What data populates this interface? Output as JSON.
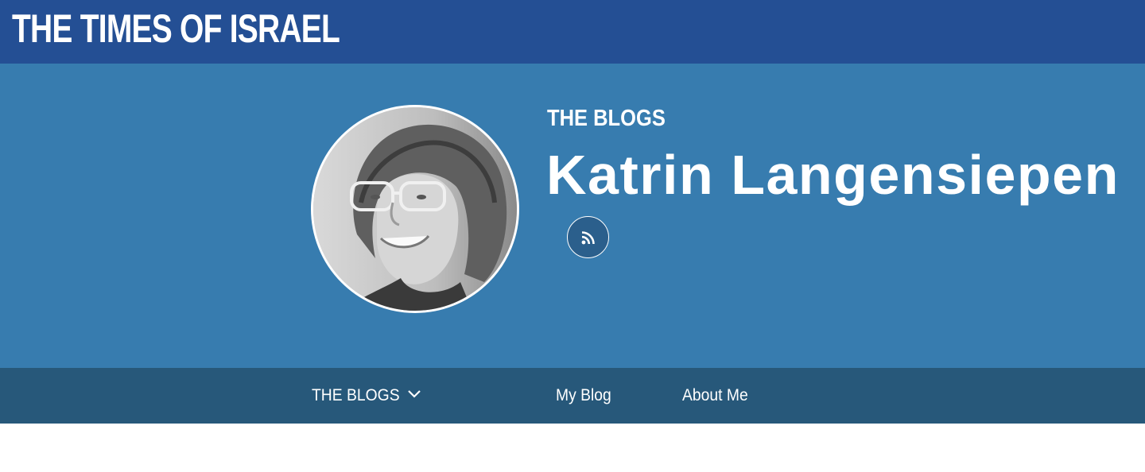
{
  "header": {
    "logo_text": "THE TIMES OF ISRAEL",
    "background": "#244f94"
  },
  "hero": {
    "section_label": "THE BLOGS",
    "author_name": "Katrin Langensiepen",
    "avatar_alt": "Katrin Langensiepen",
    "rss_icon": "rss-icon",
    "background": "#377caf"
  },
  "nav": {
    "background": "#27587a",
    "items": [
      {
        "label": "THE BLOGS",
        "icon": "chevron-down-icon"
      },
      {
        "label": "My Blog"
      },
      {
        "label": "About Me"
      }
    ]
  }
}
